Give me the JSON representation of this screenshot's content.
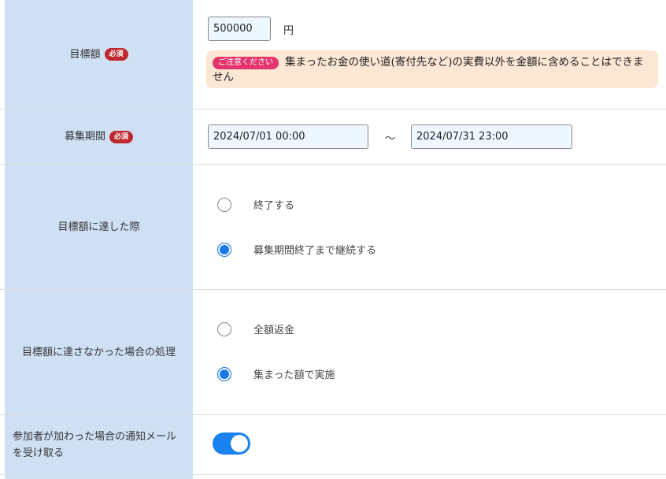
{
  "target_amount": {
    "label": "目標額",
    "required_badge": "必須",
    "value": "500000",
    "unit": "円",
    "notice_badge": "ご注意ください",
    "notice_text": "集まったお金の使い道(寄付先など)の実費以外を金額に含めることはできません"
  },
  "period": {
    "label": "募集期間",
    "required_badge": "必須",
    "start": "2024/07/01 00:00",
    "separator": "〜",
    "end": "2024/07/31 23:00"
  },
  "on_reach": {
    "label": "目標額に達した際",
    "options": [
      "終了する",
      "募集期間終了まで継続する"
    ],
    "selected_index": 1
  },
  "on_not_reach": {
    "label": "目標額に達さなかった場合の処理",
    "options": [
      "全額返金",
      "集まった額で実施"
    ],
    "selected_index": 1
  },
  "notify": {
    "label": "参加者が加わった場合の通知メールを受け取る",
    "enabled": true
  },
  "colors": {
    "label_bg": "#cfe0f4",
    "required": "#c0282f",
    "notice_bg": "#fce6d4",
    "notice_badge": "#e3356b",
    "accent": "#1877f2"
  }
}
